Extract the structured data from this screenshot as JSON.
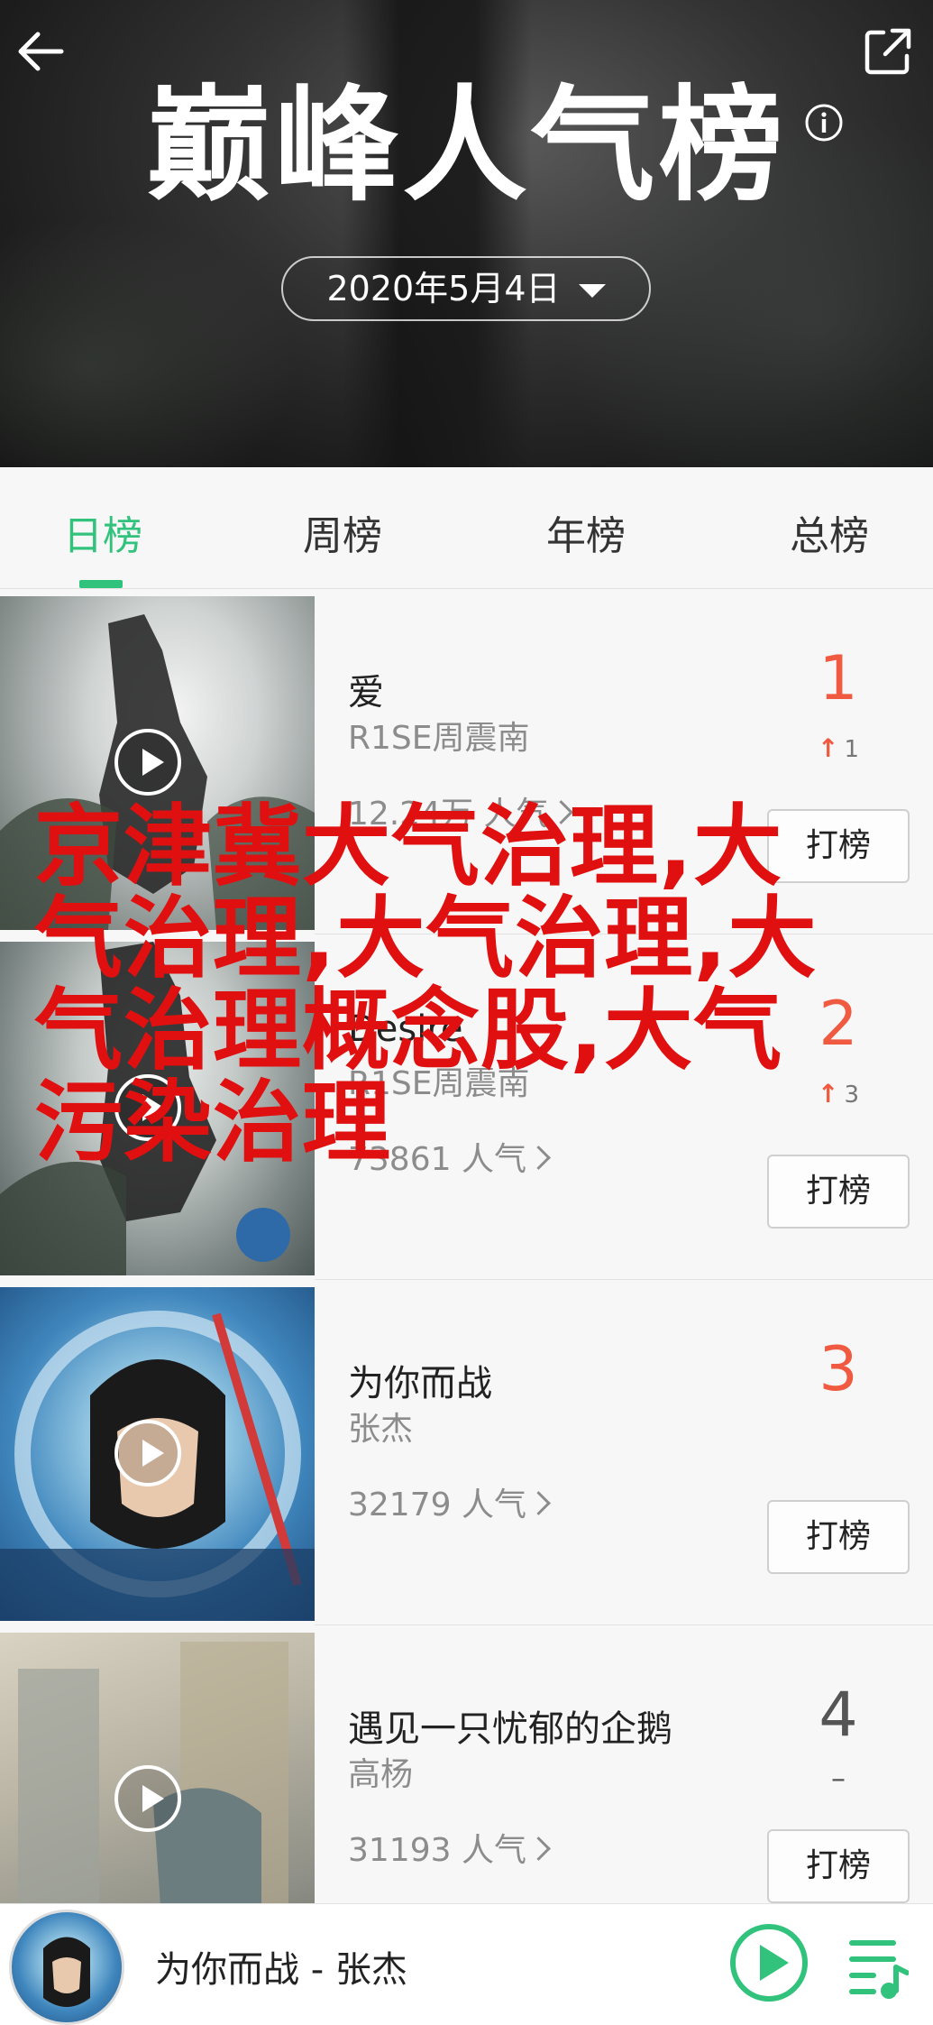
{
  "header": {
    "title": "巅峰人气榜",
    "date": "2020年5月4日",
    "back_icon": "arrow-left-icon",
    "share_icon": "share-icon",
    "info_icon": "info-icon",
    "dropdown_icon": "caret-down-icon"
  },
  "tabs": [
    {
      "label": "日榜",
      "active": true
    },
    {
      "label": "周榜",
      "active": false
    },
    {
      "label": "年榜",
      "active": false
    },
    {
      "label": "总榜",
      "active": false
    }
  ],
  "songs": [
    {
      "rank": "1",
      "title": "爱",
      "artist": "R1SE周震南",
      "popularity": "12.24万 人气",
      "change": "1",
      "change_dir": "up",
      "vote_label": "打榜"
    },
    {
      "rank": "2",
      "title": "Desire",
      "artist": "R1SE周震南",
      "popularity": "73861 人气",
      "change": "3",
      "change_dir": "up",
      "vote_label": "打榜"
    },
    {
      "rank": "3",
      "title": "为你而战",
      "artist": "张杰",
      "popularity": "32179 人气",
      "change": "",
      "change_dir": "none",
      "vote_label": "打榜"
    },
    {
      "rank": "4",
      "title": "遇见一只忧郁的企鹅",
      "artist": "高杨",
      "popularity": "31193 人气",
      "change": "–",
      "change_dir": "same",
      "vote_label": "打榜"
    }
  ],
  "overlay_text": "京津冀大气治理,大气治理,大气治理,大气治理概念股,大气污染治理",
  "player": {
    "now_playing": "为你而战 - 张杰",
    "play_icon": "play-circle-icon",
    "playlist_icon": "playlist-icon"
  },
  "colors": {
    "accent": "#31c27c",
    "rank_top": "#f05a40",
    "overlay": "#e01010"
  }
}
